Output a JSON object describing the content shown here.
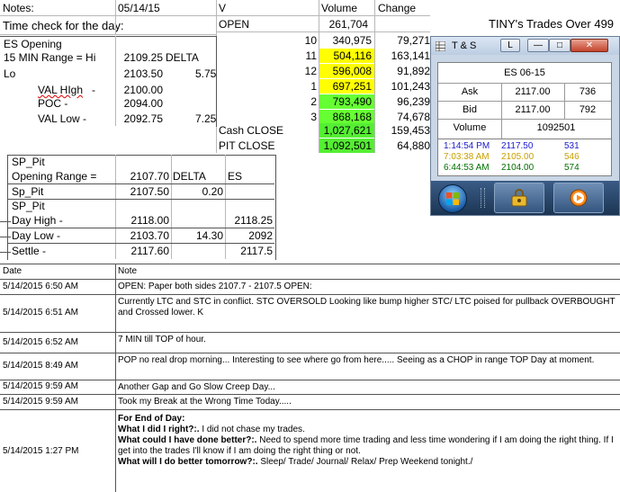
{
  "sheet": {
    "notes_label": "Notes:",
    "notes_date": "05/14/15",
    "time_check": "Time check for the day:",
    "title": "TINY's Trades Over 499",
    "volume_table": {
      "col_v": "V",
      "col_volume": "Volume",
      "col_change": "Change",
      "open_label": "OPEN",
      "open_volume": "261,704",
      "rows": [
        {
          "label": "10",
          "volume": "340,975",
          "change": "79,271"
        },
        {
          "label": "11",
          "volume": "504,116",
          "change": "163,141"
        },
        {
          "label": "12",
          "volume": "596,008",
          "change": "91,892"
        },
        {
          "label": "1",
          "volume": "697,251",
          "change": "101,243"
        },
        {
          "label": "2",
          "volume": "793,490",
          "change": "96,239"
        },
        {
          "label": "3",
          "volume": "868,168",
          "change": "74,678"
        }
      ],
      "cash_close_label": "Cash CLOSE",
      "cash_close_volume": "1,027,621",
      "cash_close_change": "159,453",
      "pit_close_label": "PIT CLOSE",
      "pit_close_volume": "1,092,501",
      "pit_close_change": "64,880"
    },
    "es_opening": {
      "title": "ES Opening",
      "range_label": "15 MIN Range = Hi",
      "range_value": "2109.25",
      "delta_label": "DELTA",
      "lo_label": "Lo",
      "lo_value": "2103.50",
      "lo_delta": "5.75",
      "val_high_label": "VAL HIgh   -",
      "val_high_value": "2100.00",
      "poc_label": "POC   -",
      "poc_value": "2094.00",
      "val_low_label": "VAL Low   -",
      "val_low_value": "2092.75",
      "val_low_delta": "7.25"
    },
    "sp_pit": {
      "title": "SP_Pit",
      "opening_range_label": "Opening Range =",
      "opening_range_value": "2107.70",
      "delta_label": "DELTA",
      "es_label": "ES",
      "sp_pit_label": "Sp_Pit",
      "sp_pit_value": "2107.50",
      "sp_pit_delta": "0.20",
      "sp_pit_title2": "SP_Pit",
      "day_high_label": "Day High -",
      "day_high_value": "2118.00",
      "day_high_es": "2118.25",
      "day_low_label": "Day Low -",
      "day_low_value": "2103.70",
      "day_low_delta": "14.30",
      "day_low_es": "2092",
      "settle_label": "Settle -",
      "settle_value": "2117.60",
      "settle_es": "2117.5"
    },
    "notes_table": {
      "col_date": "Date",
      "col_note": "Note",
      "rows": [
        {
          "date": "5/14/2015 6:50 AM",
          "note": "OPEN: Paper both sides 2107.7 - 2107.5 OPEN:"
        },
        {
          "date": "5/14/2015 6:51 AM",
          "note": "Currently LTC and STC in conflict.  STC OVERSOLD Looking like bump higher STC/ LTC poised for pullback OVERBOUGHT and Crossed lower. K"
        },
        {
          "date": "5/14/2015 6:52 AM",
          "note": "7 MIN till TOP of hour."
        },
        {
          "date": "5/14/2015 8:49 AM",
          "note": "POP no real drop morning... Interesting to see where go from here..... Seeing as a CHOP in range TOP Day at moment."
        },
        {
          "date": "5/14/2015 9:59 AM",
          "note": "Another Gap and Go Slow Creep Day..."
        },
        {
          "date": "5/14/2015 9:59 AM",
          "note": "Took my Break at the Wrong Time Today....."
        }
      ],
      "last_row": {
        "date": "5/14/2015 1:27 PM",
        "line1": "For End of Day:",
        "q1": "What I did I right?:.",
        "a1": "  I did not chase my trades.",
        "q2": "What could I have done better?:.",
        "a2": "  Need to spend more time trading and less time wondering if I am doing the right thing.  If I get into the trades I'll know if I am doing the right thing or not.",
        "q3": "What will I do better tomorrow?:.",
        "a3": "  Sleep/ Trade/ Journal/ Relax/ Prep Weekend tonight./"
      }
    }
  },
  "ts_window": {
    "title": "T & S",
    "l_button": "L",
    "minimize_glyph": "—",
    "maximize_glyph": "□",
    "close_glyph": "✕",
    "symbol": "ES 06-15",
    "ask_label": "Ask",
    "ask_price": "2117.00",
    "ask_size": "736",
    "bid_label": "Bid",
    "bid_price": "2117.00",
    "bid_size": "792",
    "volume_label": "Volume",
    "volume_value": "1092501",
    "trades": [
      {
        "time": "1:14:54 PM",
        "price": "2117.50",
        "size": "531",
        "color": "#1a1acc"
      },
      {
        "time": "7:03:38 AM",
        "price": "2105.00",
        "size": "546",
        "color": "#c8a000"
      },
      {
        "time": "6:44:53 AM",
        "price": "2104.00",
        "size": "574",
        "color": "#007000"
      }
    ]
  },
  "colors": {
    "yellow_cells": "#ffff00",
    "green_cells": "#66ff33"
  }
}
